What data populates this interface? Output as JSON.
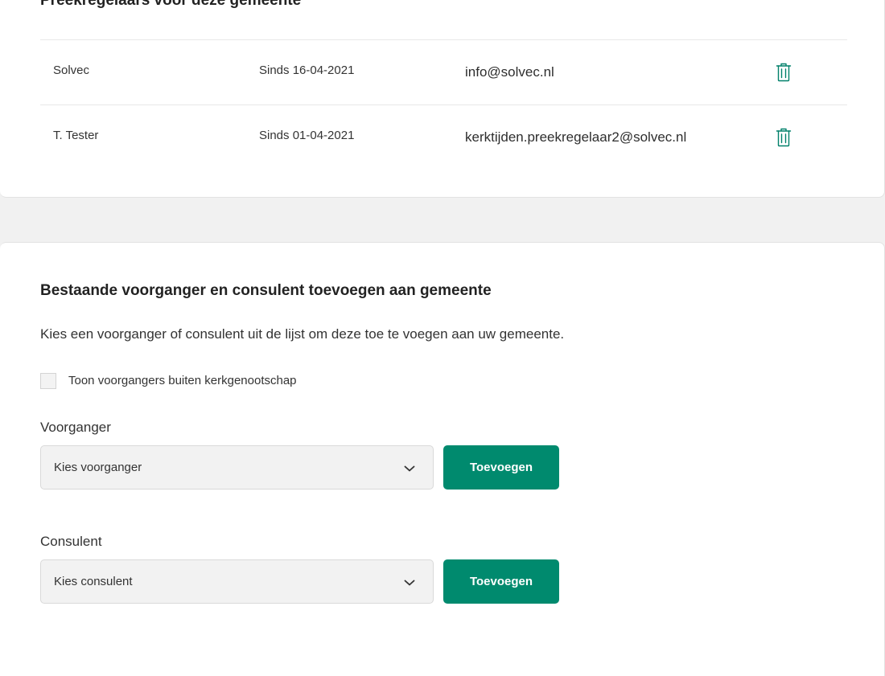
{
  "preekregelaars": {
    "title": "Preekregelaars voor deze gemeente",
    "rows": [
      {
        "name": "Solvec",
        "since": "Sinds 16-04-2021",
        "email": "info@solvec.nl"
      },
      {
        "name": "T. Tester",
        "since": "Sinds 01-04-2021",
        "email": "kerktijden.preekregelaar2@solvec.nl"
      }
    ],
    "delete_icon": "trash-icon"
  },
  "add_section": {
    "title": "Bestaande voorganger en consulent toevoegen aan gemeente",
    "intro": "Kies een voorganger of consulent uit de lijst om deze toe te voegen aan uw gemeente.",
    "checkbox_label": "Toon voorgangers buiten kerkgenootschap",
    "voorganger": {
      "label": "Voorganger",
      "select_value": "Kies voorganger",
      "button_label": "Toevoegen"
    },
    "consulent": {
      "label": "Consulent",
      "select_value": "Kies consulent",
      "button_label": "Toevoegen"
    }
  },
  "colors": {
    "accent": "#008a6e",
    "page_background": "#f1f1f1",
    "card_background": "#ffffff"
  }
}
